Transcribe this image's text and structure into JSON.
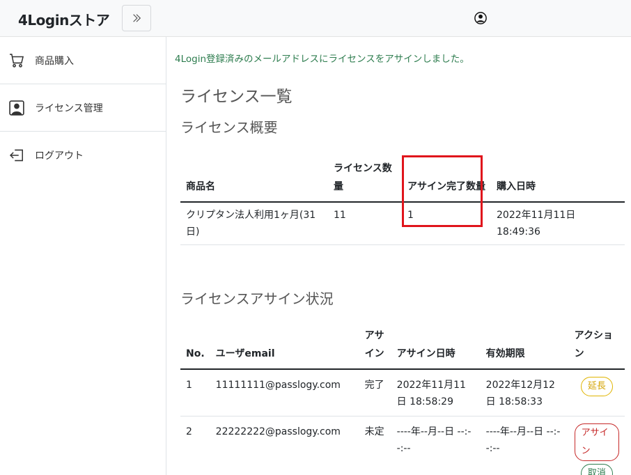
{
  "header": {
    "brand": "4Loginストア",
    "toggle_icon": "chevron-double-right-icon",
    "user_icon": "person-circle-icon"
  },
  "sidebar": {
    "items": [
      {
        "label": "商品購入",
        "icon": "cart-icon"
      },
      {
        "label": "ライセンス管理",
        "icon": "person-badge-icon"
      },
      {
        "label": "ログアウト",
        "icon": "logout-icon"
      }
    ]
  },
  "main": {
    "alert": "4Login登録済みのメールアドレスにライセンスをアサインしました。",
    "title": "ライセンス一覧",
    "summary": {
      "heading": "ライセンス概要",
      "headers": [
        "商品名",
        "ライセンス数量",
        "アサイン完了数量",
        "購入日時"
      ],
      "rows": [
        [
          "クリプタン法人利用1ヶ月(31日)",
          "11",
          "1",
          "2022年11月11日 18:49:36"
        ]
      ]
    },
    "assign": {
      "heading": "ライセンスアサイン状況",
      "headers": [
        "No.",
        "ユーザemail",
        "アサイン",
        "アサイン日時",
        "有効期限",
        "アクション"
      ],
      "rows": [
        {
          "no": "1",
          "email": "11111111@passlogy.com",
          "status": "完了",
          "assigned_at": "2022年11月11日 18:58:29",
          "expires": "2022年12月12日 18:58:33",
          "actions": [
            "延長"
          ]
        },
        {
          "no": "2",
          "email": "22222222@passlogy.com",
          "status": "未定",
          "assigned_at": "----年--月--日 --:--:--",
          "expires": "----年--月--日 --:--:--",
          "actions": [
            "アサイン",
            "取消"
          ]
        }
      ]
    }
  },
  "colors": {
    "accent_green": "#2e7d4f",
    "highlight_red": "#e0151c",
    "extend_yellow": "#e0b400",
    "assign_red": "#c62828"
  }
}
